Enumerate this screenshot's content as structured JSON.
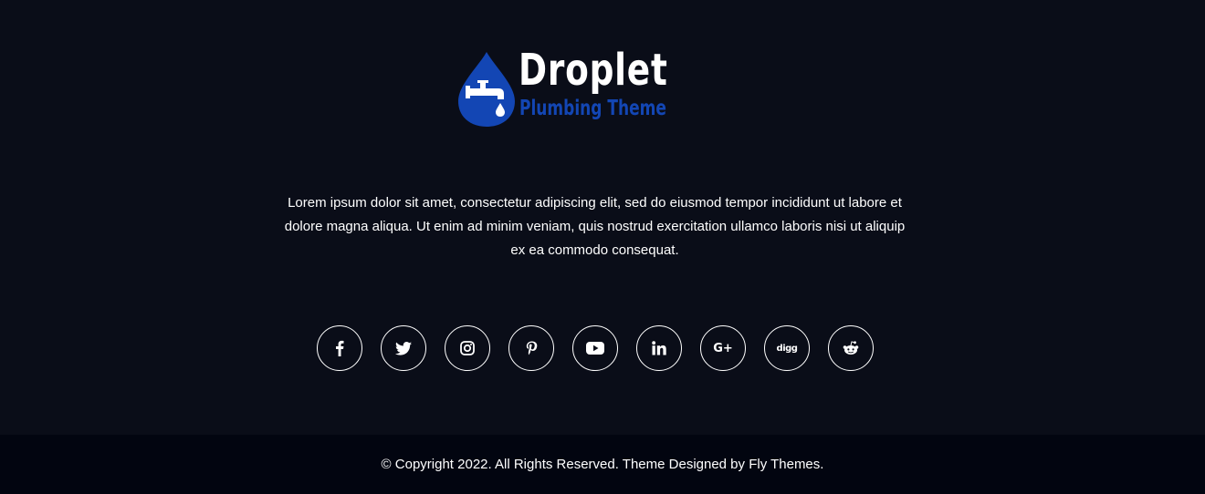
{
  "brand": {
    "name": "Droplet",
    "tagline": "Plumbing Theme",
    "colors": {
      "primary": "#1346b4",
      "text": "#ffffff",
      "background": "#0a0d18",
      "bottom_bar": "#020510"
    }
  },
  "description": "Lorem ipsum dolor sit amet, consectetur adipiscing elit, sed do eiusmod tempor incididunt ut labore et dolore magna aliqua. Ut enim ad minim veniam, quis nostrud exercitation ullamco laboris nisi ut aliquip ex ea commodo consequat.",
  "social": [
    {
      "icon": "facebook-icon"
    },
    {
      "icon": "twitter-icon"
    },
    {
      "icon": "instagram-icon"
    },
    {
      "icon": "pinterest-icon"
    },
    {
      "icon": "youtube-icon"
    },
    {
      "icon": "linkedin-icon"
    },
    {
      "icon": "google-plus-icon",
      "text": "G+"
    },
    {
      "icon": "digg-icon",
      "text": "digg"
    },
    {
      "icon": "reddit-icon"
    }
  ],
  "footer": {
    "copyright_prefix": "© Copyright 2022. All Rights Reserved. Theme Designed by",
    "designer_link": "Fly Themes",
    "copyright_suffix": "."
  }
}
